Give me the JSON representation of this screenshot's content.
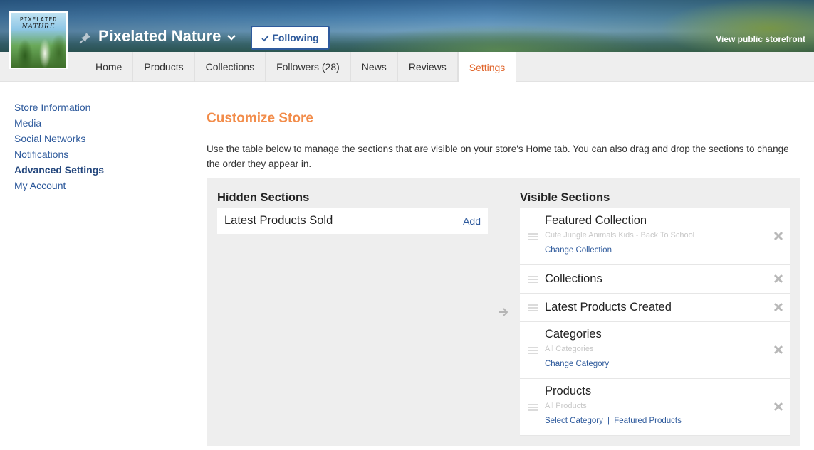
{
  "header": {
    "logo_line1": "PIXELATED",
    "logo_line2": "NATURE",
    "store_name": "Pixelated Nature",
    "follow_label": "Following",
    "view_public_label": "View public storefront",
    "icons": {
      "pin": "pin-icon",
      "dropdown": "chevron-down-icon",
      "check": "check-icon"
    }
  },
  "tabs": [
    {
      "label": "Home",
      "active": false
    },
    {
      "label": "Products",
      "active": false
    },
    {
      "label": "Collections",
      "active": false
    },
    {
      "label": "Followers (28)",
      "active": false
    },
    {
      "label": "News",
      "active": false
    },
    {
      "label": "Reviews",
      "active": false
    },
    {
      "label": "Settings",
      "active": true
    }
  ],
  "sidebar": {
    "items": [
      {
        "label": "Store Information"
      },
      {
        "label": "Media"
      },
      {
        "label": "Social Networks"
      },
      {
        "label": "Notifications"
      },
      {
        "label": "Advanced Settings",
        "active": true
      },
      {
        "label": "My Account"
      }
    ]
  },
  "main": {
    "title": "Customize Store",
    "intro": "Use the table below to manage the sections that are visible on your store's Home tab. You can also drag and drop the sections to change the order they appear in.",
    "hidden_heading": "Hidden Sections",
    "visible_heading": "Visible Sections",
    "hidden_sections": [
      {
        "label": "Latest Products Sold",
        "action": "Add"
      }
    ],
    "visible_sections": [
      {
        "title": "Featured Collection",
        "subtitle": "Cute Jungle Animals Kids - Back To School",
        "links": [
          "Change Collection"
        ]
      },
      {
        "title": "Collections"
      },
      {
        "title": "Latest Products Created"
      },
      {
        "title": "Categories",
        "subtitle": "All Categories",
        "links": [
          "Change Category"
        ]
      },
      {
        "title": "Products",
        "subtitle": "All Products",
        "links": [
          "Select Category",
          "Featured Products"
        ],
        "link_separator": "|"
      }
    ]
  },
  "colors": {
    "accent_orange": "#f28c4a",
    "active_tab": "#e0642a",
    "link_blue": "#2e5a9c"
  }
}
